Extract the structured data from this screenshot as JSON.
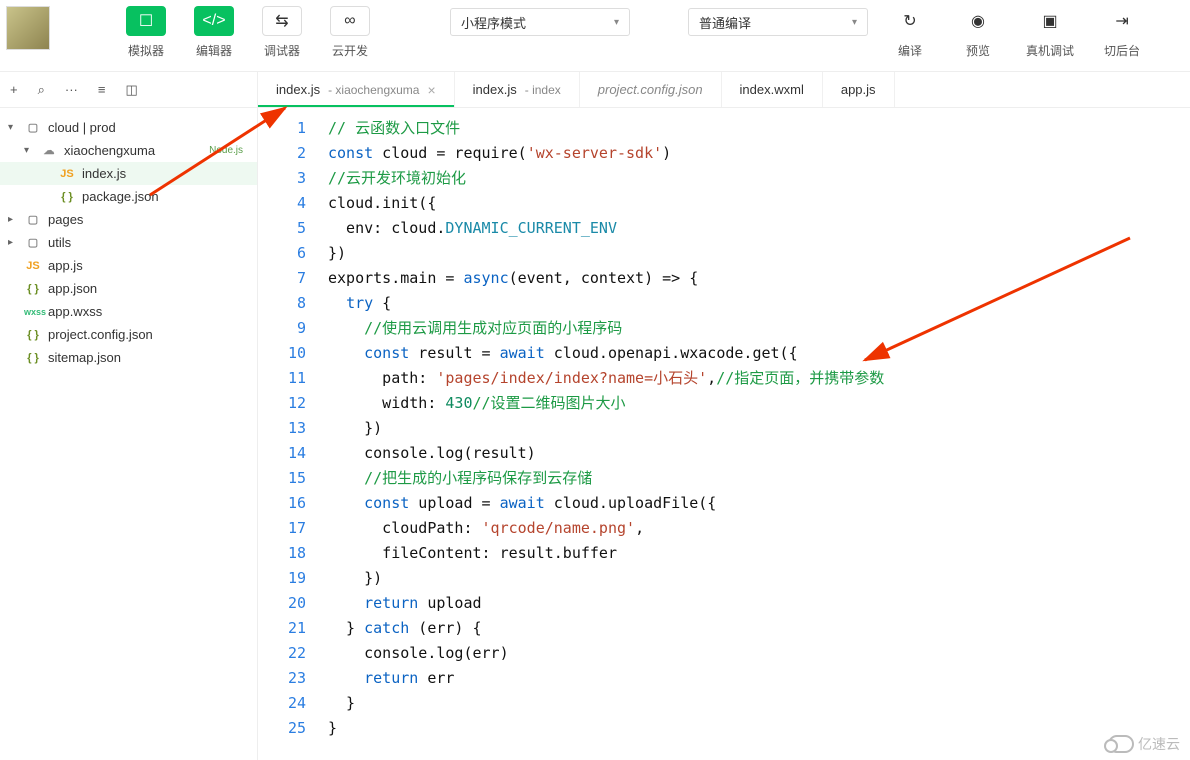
{
  "toolbar": {
    "simulator": "模拟器",
    "editor": "编辑器",
    "debugger": "调试器",
    "cloud_dev": "云开发",
    "mode_dropdown": "小程序模式",
    "compile_dropdown": "普通编译",
    "compile": "编译",
    "preview": "预览",
    "remote_debug": "真机调试",
    "switch_bg": "切后台"
  },
  "tabs": [
    {
      "file": "index.js",
      "sub": "xiaochengxuma",
      "active": true,
      "closable": true
    },
    {
      "file": "index.js",
      "sub": "index",
      "active": false
    },
    {
      "file": "project.config.json",
      "sub": "",
      "italic": true
    },
    {
      "file": "index.wxml",
      "sub": ""
    },
    {
      "file": "app.js",
      "sub": ""
    }
  ],
  "tree": [
    {
      "name": "cloud | prod",
      "type": "folder",
      "caret": "▾",
      "indent": 0,
      "icon": "folder"
    },
    {
      "name": "xiaochengxuma",
      "type": "cloud",
      "caret": "▾",
      "indent": 1,
      "icon": "cloud",
      "badge": "Node.js"
    },
    {
      "name": "index.js",
      "type": "js",
      "indent": 2,
      "icon": "js",
      "selected": true
    },
    {
      "name": "package.json",
      "type": "json",
      "indent": 2,
      "icon": "json"
    },
    {
      "name": "pages",
      "type": "folder",
      "caret": "▸",
      "indent": 0,
      "icon": "folder"
    },
    {
      "name": "utils",
      "type": "folder",
      "caret": "▸",
      "indent": 0,
      "icon": "folder"
    },
    {
      "name": "app.js",
      "type": "js",
      "indent": 0,
      "icon": "js"
    },
    {
      "name": "app.json",
      "type": "json",
      "indent": 0,
      "icon": "json"
    },
    {
      "name": "app.wxss",
      "type": "wxss",
      "indent": 0,
      "icon": "wxss"
    },
    {
      "name": "project.config.json",
      "type": "json",
      "indent": 0,
      "icon": "json"
    },
    {
      "name": "sitemap.json",
      "type": "json",
      "indent": 0,
      "icon": "json"
    }
  ],
  "code": {
    "lines": [
      [
        [
          "cm",
          "// 云函数入口文件"
        ]
      ],
      [
        [
          "kw",
          "const"
        ],
        [
          "id",
          " cloud = require("
        ],
        [
          "str",
          "'wx-server-sdk'"
        ],
        [
          "id",
          ")"
        ]
      ],
      [
        [
          "cm",
          "//云开发环境初始化"
        ]
      ],
      [
        [
          "id",
          "cloud.init({"
        ]
      ],
      [
        [
          "id",
          "  env: cloud."
        ],
        [
          "prop",
          "DYNAMIC_CURRENT_ENV"
        ]
      ],
      [
        [
          "id",
          "})"
        ]
      ],
      [
        [
          "id",
          "exports.main = "
        ],
        [
          "kw",
          "async"
        ],
        [
          "id",
          "(event, context) => {"
        ]
      ],
      [
        [
          "id",
          "  "
        ],
        [
          "kw",
          "try"
        ],
        [
          "id",
          " {"
        ]
      ],
      [
        [
          "id",
          "    "
        ],
        [
          "cm",
          "//使用云调用生成对应页面的小程序码"
        ]
      ],
      [
        [
          "id",
          "    "
        ],
        [
          "kw",
          "const"
        ],
        [
          "id",
          " result = "
        ],
        [
          "kw",
          "await"
        ],
        [
          "id",
          " cloud.openapi.wxacode.get({"
        ]
      ],
      [
        [
          "id",
          "      path: "
        ],
        [
          "str",
          "'pages/index/index?name=小石头'"
        ],
        [
          "id",
          ","
        ],
        [
          "cm",
          "//指定页面，并携带参数"
        ]
      ],
      [
        [
          "id",
          "      width: "
        ],
        [
          "num",
          "430"
        ],
        [
          "cm",
          "//设置二维码图片大小"
        ]
      ],
      [
        [
          "id",
          "    })"
        ]
      ],
      [
        [
          "id",
          "    console.log(result)"
        ]
      ],
      [
        [
          "id",
          "    "
        ],
        [
          "cm",
          "//把生成的小程序码保存到云存储"
        ]
      ],
      [
        [
          "id",
          "    "
        ],
        [
          "kw",
          "const"
        ],
        [
          "id",
          " upload = "
        ],
        [
          "kw",
          "await"
        ],
        [
          "id",
          " cloud.uploadFile({"
        ]
      ],
      [
        [
          "id",
          "      cloudPath: "
        ],
        [
          "str",
          "'qrcode/name.png'"
        ],
        [
          "id",
          ","
        ]
      ],
      [
        [
          "id",
          "      fileContent: result.buffer"
        ]
      ],
      [
        [
          "id",
          "    })"
        ]
      ],
      [
        [
          "id",
          "    "
        ],
        [
          "kw",
          "return"
        ],
        [
          "id",
          " upload"
        ]
      ],
      [
        [
          "id",
          "  } "
        ],
        [
          "kw",
          "catch"
        ],
        [
          "id",
          " (err) {"
        ]
      ],
      [
        [
          "id",
          "    console.log(err)"
        ]
      ],
      [
        [
          "id",
          "    "
        ],
        [
          "kw",
          "return"
        ],
        [
          "id",
          " err"
        ]
      ],
      [
        [
          "id",
          "  }"
        ]
      ],
      [
        [
          "id",
          "}"
        ]
      ]
    ]
  },
  "icons": {
    "plus": "+",
    "search": "⌕",
    "more": "···",
    "outline": "≡",
    "split": "◫",
    "phone": "☐",
    "code": "</>",
    "settings": "⇆",
    "link": "∞",
    "refresh": "↻",
    "eye": "◉",
    "device": "▣",
    "switch": "⇥",
    "folder": "▢",
    "cloud": "☁",
    "js": "JS",
    "json": "{ }",
    "wxss": "wxss"
  },
  "watermark": "亿速云"
}
